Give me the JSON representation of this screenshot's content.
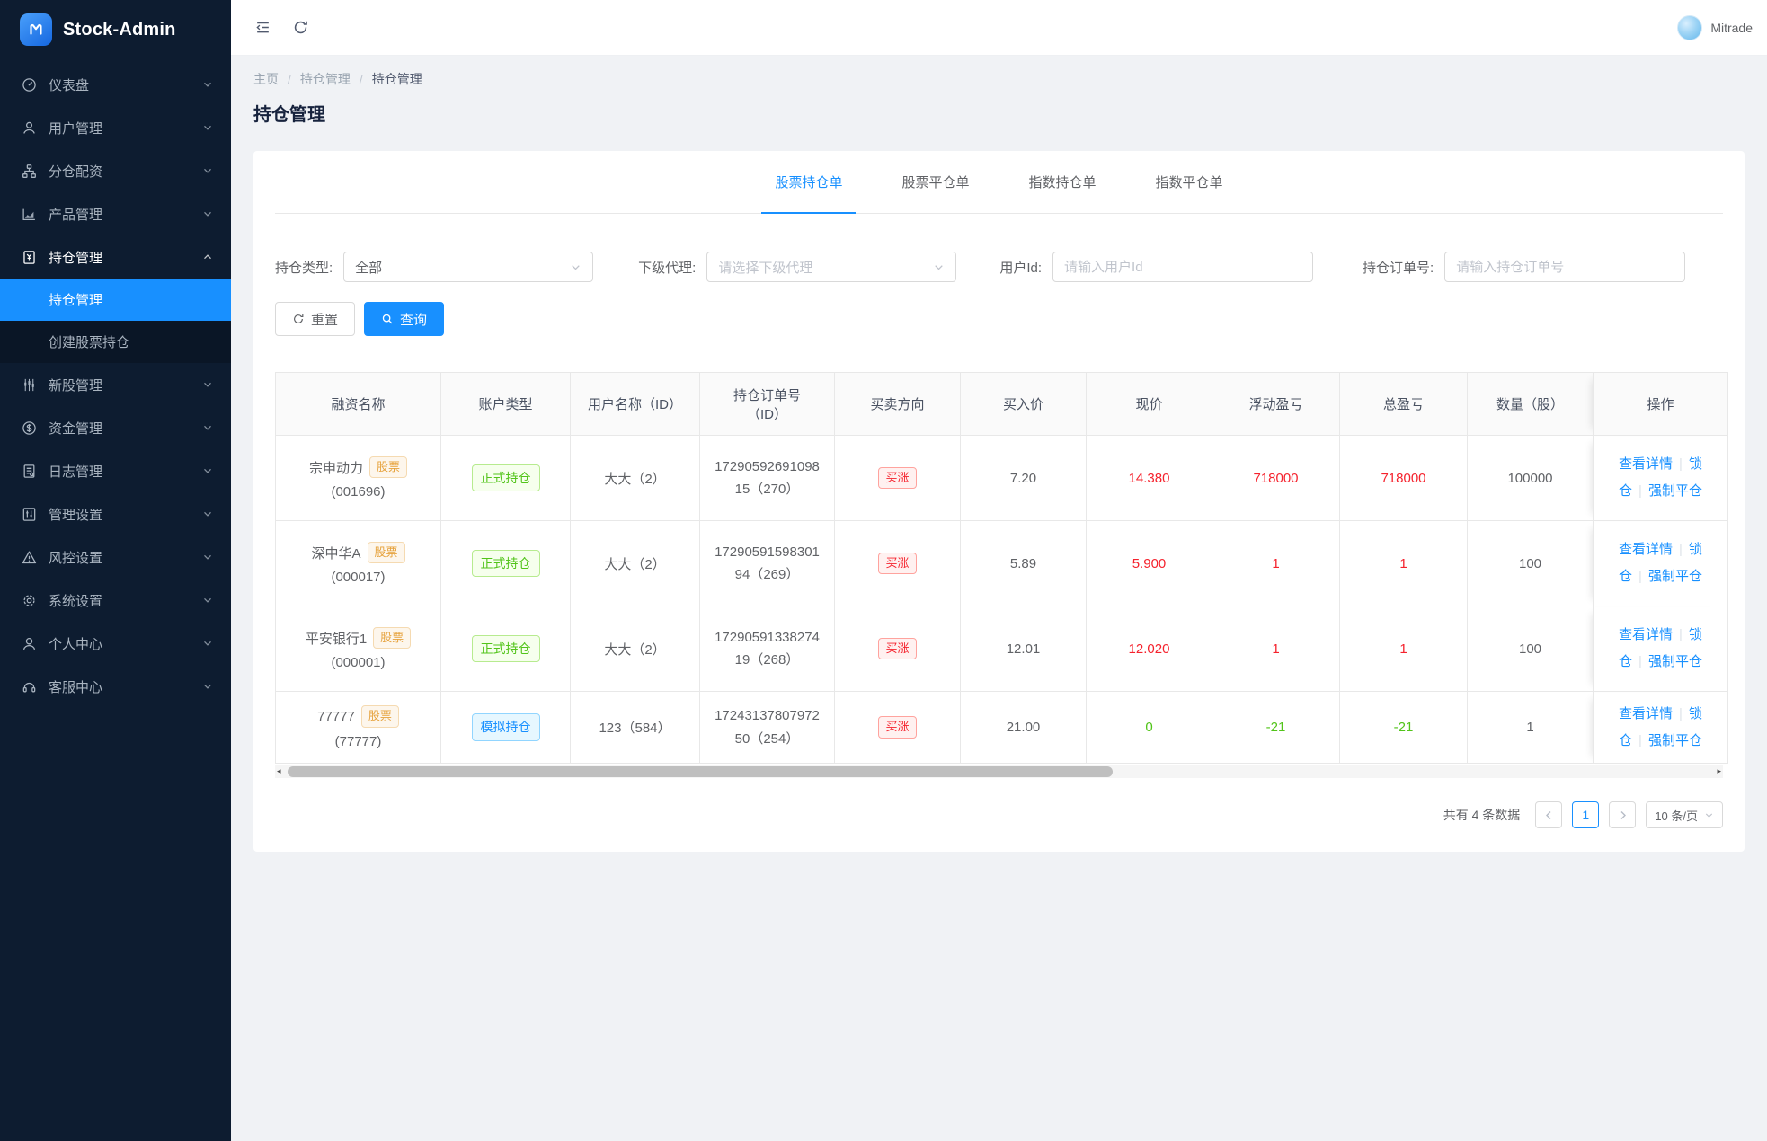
{
  "sidebar": {
    "logo_text": "Stock-Admin",
    "items": [
      {
        "label": "仪表盘"
      },
      {
        "label": "用户管理"
      },
      {
        "label": "分仓配资"
      },
      {
        "label": "产品管理"
      },
      {
        "label": "持仓管理",
        "children": [
          {
            "label": "持仓管理"
          },
          {
            "label": "创建股票持仓"
          }
        ]
      },
      {
        "label": "新股管理"
      },
      {
        "label": "资金管理"
      },
      {
        "label": "日志管理"
      },
      {
        "label": "管理设置"
      },
      {
        "label": "风控设置"
      },
      {
        "label": "系统设置"
      },
      {
        "label": "个人中心"
      },
      {
        "label": "客服中心"
      }
    ]
  },
  "topbar": {
    "user_name": "Mitrade"
  },
  "breadcrumb": {
    "home": "主页",
    "level1": "持仓管理",
    "current": "持仓管理"
  },
  "page": {
    "title": "持仓管理"
  },
  "tabs": [
    {
      "label": "股票持仓单"
    },
    {
      "label": "股票平仓单"
    },
    {
      "label": "指数持仓单"
    },
    {
      "label": "指数平仓单"
    }
  ],
  "filters": {
    "type_label": "持仓类型:",
    "type_value": "全部",
    "agent_label": "下级代理:",
    "agent_placeholder": "请选择下级代理",
    "user_label": "用户Id:",
    "user_placeholder": "请输入用户Id",
    "order_label": "持仓订单号:",
    "order_placeholder": "请输入持仓订单号",
    "reset_label": "重置",
    "query_label": "查询"
  },
  "table": {
    "headers": [
      "融资名称",
      "账户类型",
      "用户名称（ID）",
      "持仓订单号（ID）",
      "买卖方向",
      "买入价",
      "现价",
      "浮动盈亏",
      "总盈亏",
      "数量（股）",
      "操作"
    ],
    "actions": {
      "detail": "查看详情",
      "lock": "锁仓",
      "force_close": "强制平仓"
    },
    "rows": [
      {
        "name": "宗申动力",
        "name_tag": "股票",
        "code": "(001696)",
        "account_type": "正式持仓",
        "account_variant": "green",
        "user": "大大（2）",
        "order_no": "1729059269109815（270）",
        "direction": "买涨",
        "buy_price": "7.20",
        "current_price": "14.380",
        "current_tone": "red",
        "float_pnl": "718000",
        "float_tone": "red",
        "total_pnl": "718000",
        "total_tone": "red",
        "quantity": "100000"
      },
      {
        "name": "深中华A",
        "name_tag": "股票",
        "code": "(000017)",
        "account_type": "正式持仓",
        "account_variant": "green",
        "user": "大大（2）",
        "order_no": "1729059159830194（269）",
        "direction": "买涨",
        "buy_price": "5.89",
        "current_price": "5.900",
        "current_tone": "red",
        "float_pnl": "1",
        "float_tone": "red",
        "total_pnl": "1",
        "total_tone": "red",
        "quantity": "100"
      },
      {
        "name": "平安银行1",
        "name_tag": "股票",
        "code": "(000001)",
        "account_type": "正式持仓",
        "account_variant": "green",
        "user": "大大（2）",
        "order_no": "1729059133827419（268）",
        "direction": "买涨",
        "buy_price": "12.01",
        "current_price": "12.020",
        "current_tone": "red",
        "float_pnl": "1",
        "float_tone": "red",
        "total_pnl": "1",
        "total_tone": "red",
        "quantity": "100"
      },
      {
        "name": "77777",
        "name_tag": "股票",
        "code": "(77777)",
        "account_type": "模拟持仓",
        "account_variant": "blue",
        "user": "123（584）",
        "order_no": "1724313780797250（254）",
        "direction": "买涨",
        "buy_price": "21.00",
        "current_price": "0",
        "current_tone": "green",
        "float_pnl": "-21",
        "float_tone": "green",
        "total_pnl": "-21",
        "total_tone": "green",
        "quantity": "1"
      }
    ]
  },
  "pagination": {
    "total_text": "共有 4 条数据",
    "current_page": "1",
    "page_size": "10 条/页"
  }
}
